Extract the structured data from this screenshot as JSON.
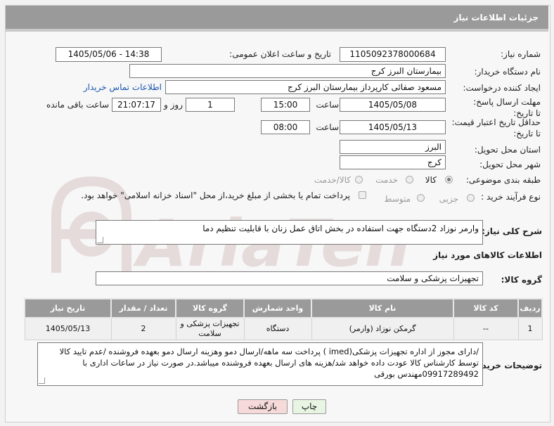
{
  "header": {
    "title": "جزئیات اطلاعات نیاز"
  },
  "fields": {
    "need_number_label": "شماره نیاز:",
    "need_number": "1105092378000684",
    "announce_label": "تاریخ و ساعت اعلان عمومی:",
    "announce_value": "1405/05/06 - 14:38",
    "buyer_org_label": "نام دستگاه خریدار:",
    "buyer_org": "بیمارستان البرز کرج",
    "creator_label": "ایجاد کننده درخواست:",
    "creator": "مسعود صفائی کارپرداز بیمارستان البرز کرج",
    "contact_link": "اطلاعات تماس خریدار",
    "deadline_label": "مهلت ارسال پاسخ: تا تاریخ:",
    "deadline_date": "1405/05/08",
    "time_label": "ساعت",
    "deadline_time": "15:00",
    "days_value": "1",
    "days_label": "روز و",
    "remaining_time": "21:07:17",
    "remaining_label": "ساعت باقی مانده",
    "validity_label": "حداقل تاریخ اعتبار قیمت: تا تاریخ:",
    "validity_date": "1405/05/13",
    "validity_time": "08:00",
    "province_label": "استان محل تحویل:",
    "province": "البرز",
    "city_label": "شهر محل تحویل:",
    "city": "کرج",
    "category_label": "طبقه بندی موضوعی:",
    "category_options": [
      "کالا",
      "خدمت",
      "کالا/خدمت"
    ],
    "process_label": "نوع فرآیند خرید :",
    "process_options": [
      "جزیی",
      "متوسط"
    ],
    "payment_note": "پرداخت تمام یا بخشی از مبلغ خرید،از محل \"اسناد خزانه اسلامی\" خواهد بود."
  },
  "description": {
    "label": "شرح کلی نیاز:",
    "text": "وارمر نوزاد 2دستگاه جهت استفاده در بخش اتاق عمل زنان با قابلیت تنظیم دما"
  },
  "goods": {
    "section_title": "اطلاعات کالاهای مورد نیاز",
    "group_label": "گروه کالا:",
    "group_value": "تجهیزات پزشکی و سلامت",
    "columns": [
      "ردیف",
      "کد کالا",
      "نام کالا",
      "واحد شمارش",
      "گروه کالا",
      "تعداد / مقدار",
      "تاریخ نیاز"
    ],
    "rows": [
      [
        "1",
        "--",
        "گرمکن نوزاد (وارمر)",
        "دستگاه",
        "تجهیزات پزشکی و سلامت",
        "2",
        "1405/05/13"
      ]
    ]
  },
  "buyer_notes": {
    "label": "توضیحات خریدار:",
    "text": "/دارای مجوز از اداره تجهیزات پزشکی(imed ) پرداخت سه ماهه/ارسال دمو وهزینه ارسال دمو بعهده فروشنده /عدم تایید کالا توسط کارشناس کالا عودت داده خواهد شد/هزینه های ارسال بعهده فروشنده میباشد.در صورت نیاز در ساعات اداری با 09917289492مهندس بورقی"
  },
  "buttons": {
    "print": "چاپ",
    "back": "بازگشت"
  },
  "watermark": {
    "text": "AriaTender.net"
  },
  "colors": {
    "header": "#9a9a9a",
    "link": "#1a56b0",
    "back_button": "#f6d9d9",
    "print_button": "#e9f5e3"
  }
}
